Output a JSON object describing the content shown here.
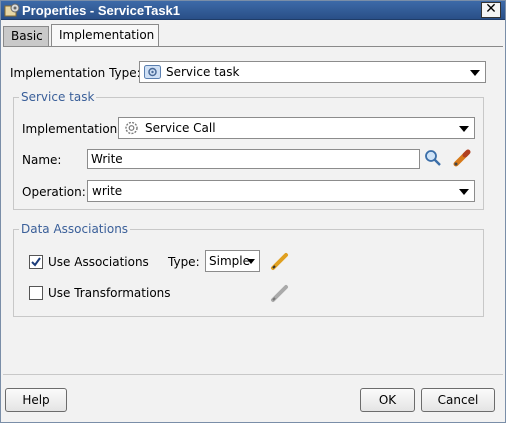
{
  "window": {
    "title": "Properties - ServiceTask1",
    "close_glyph": "✕"
  },
  "tabs": [
    {
      "label": "Basic"
    },
    {
      "label": "Implementation"
    }
  ],
  "implementation_type": {
    "label": "Implementation Type:",
    "value": "Service task",
    "icon": "gear-icon"
  },
  "service_task_group": {
    "title": "Service task",
    "implementation": {
      "label": "Implementation:",
      "value": "Service Call",
      "icon": "gear-icon"
    },
    "name": {
      "label": "Name:",
      "value": "Write"
    },
    "operation": {
      "label": "Operation:",
      "value": "write"
    }
  },
  "data_associations": {
    "title": "Data Associations",
    "use_associations": {
      "label": "Use Associations",
      "checked": true
    },
    "type_label": "Type:",
    "type_value": "Simple",
    "use_transformations": {
      "label": "Use Transformations",
      "checked": false
    }
  },
  "footer": {
    "help_label": "Help",
    "ok_label": "OK",
    "cancel_label": "Cancel"
  },
  "colors": {
    "title_bar": "#2f5a96",
    "group_title": "#3a5f99",
    "pencil_active": "#e0a020"
  }
}
